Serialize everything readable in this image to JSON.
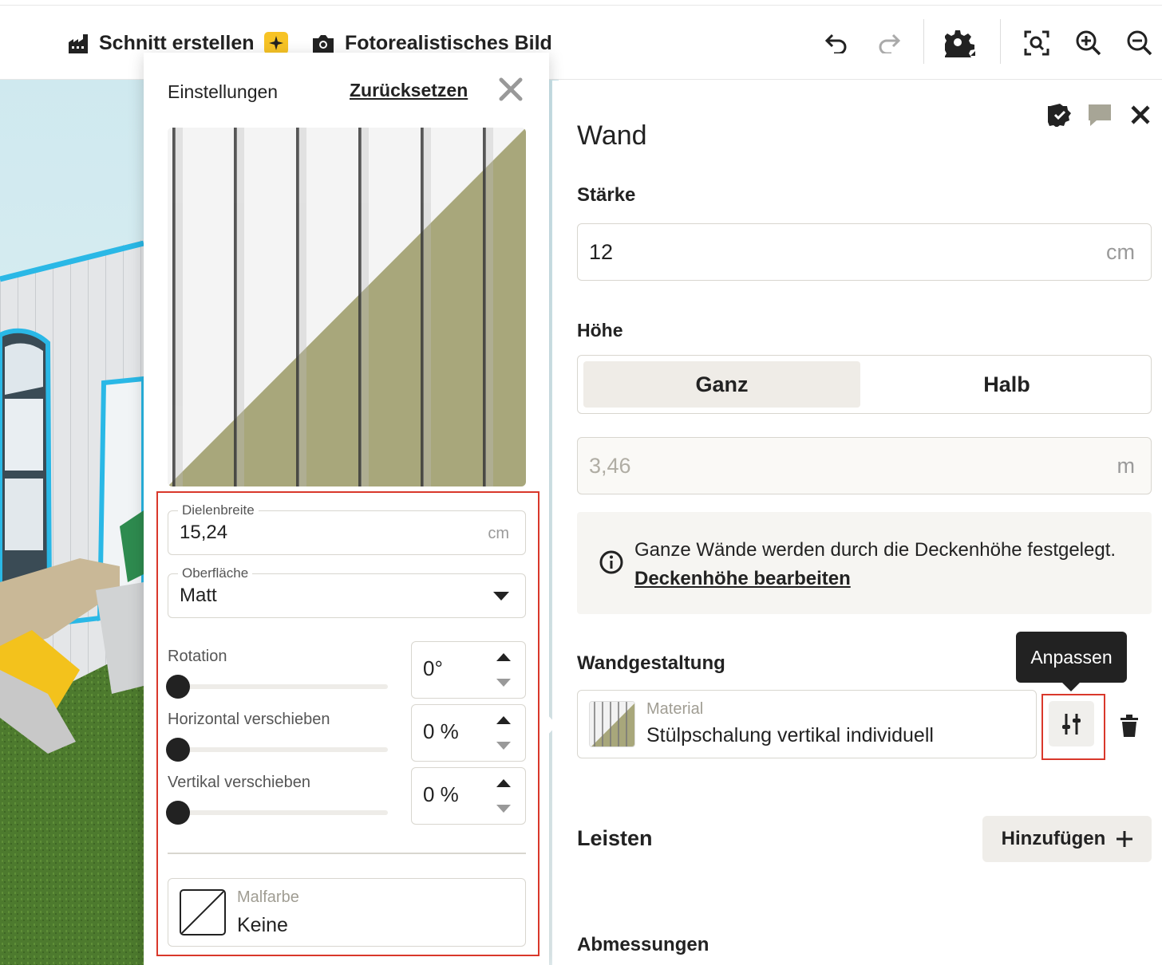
{
  "toolbar": {
    "section_label": "Schnitt erstellen",
    "photo_label": "Fotorealistisches Bild"
  },
  "icons": {
    "building": "building-icon",
    "sparkle": "sparkle-icon",
    "camera": "camera-icon",
    "undo": "undo-icon",
    "redo": "redo-icon",
    "settings": "gear-icon",
    "fit": "zoom-fit-icon",
    "zoom_in": "zoom-in-icon",
    "zoom_out": "zoom-out-icon"
  },
  "colors": {
    "accent_red": "#d9382b",
    "sparkle_yellow": "#f7c325",
    "material_olive": "#a8a77b",
    "selection_blue": "#2ab8e6"
  },
  "popover": {
    "title": "Einstellungen",
    "reset_label": "Zurücksetzen",
    "dielenbreite": {
      "label": "Dielenbreite",
      "value": "15,24",
      "unit": "cm"
    },
    "oberflaeche": {
      "label": "Oberfläche",
      "value": "Matt"
    },
    "rotation": {
      "label": "Rotation",
      "value": "0°",
      "fraction": 0
    },
    "horizontal": {
      "label": "Horizontal verschieben",
      "value": "0 %",
      "fraction": 0
    },
    "vertikal": {
      "label": "Vertikal verschieben",
      "value": "0 %",
      "fraction": 0
    },
    "malfarbe": {
      "label": "Malfarbe",
      "value": "Keine"
    }
  },
  "panel": {
    "title": "Wand",
    "staerke": {
      "label": "Stärke",
      "value": "12",
      "unit": "cm"
    },
    "hoehe": {
      "label": "Höhe",
      "options": [
        "Ganz",
        "Halb"
      ],
      "selected": "Ganz",
      "value": "3,46",
      "unit": "m"
    },
    "info": {
      "text": "Ganze Wände werden durch die Deckenhöhe festgelegt.",
      "link": "Deckenhöhe bearbeiten"
    },
    "wandgestaltung": {
      "label": "Wandgestaltung",
      "material_label": "Material",
      "material_value": "Stülpschalung vertikal individuell",
      "tooltip": "Anpassen"
    },
    "leisten": {
      "label": "Leisten",
      "add_label": "Hinzufügen"
    },
    "abmessungen": {
      "label": "Abmessungen"
    }
  }
}
